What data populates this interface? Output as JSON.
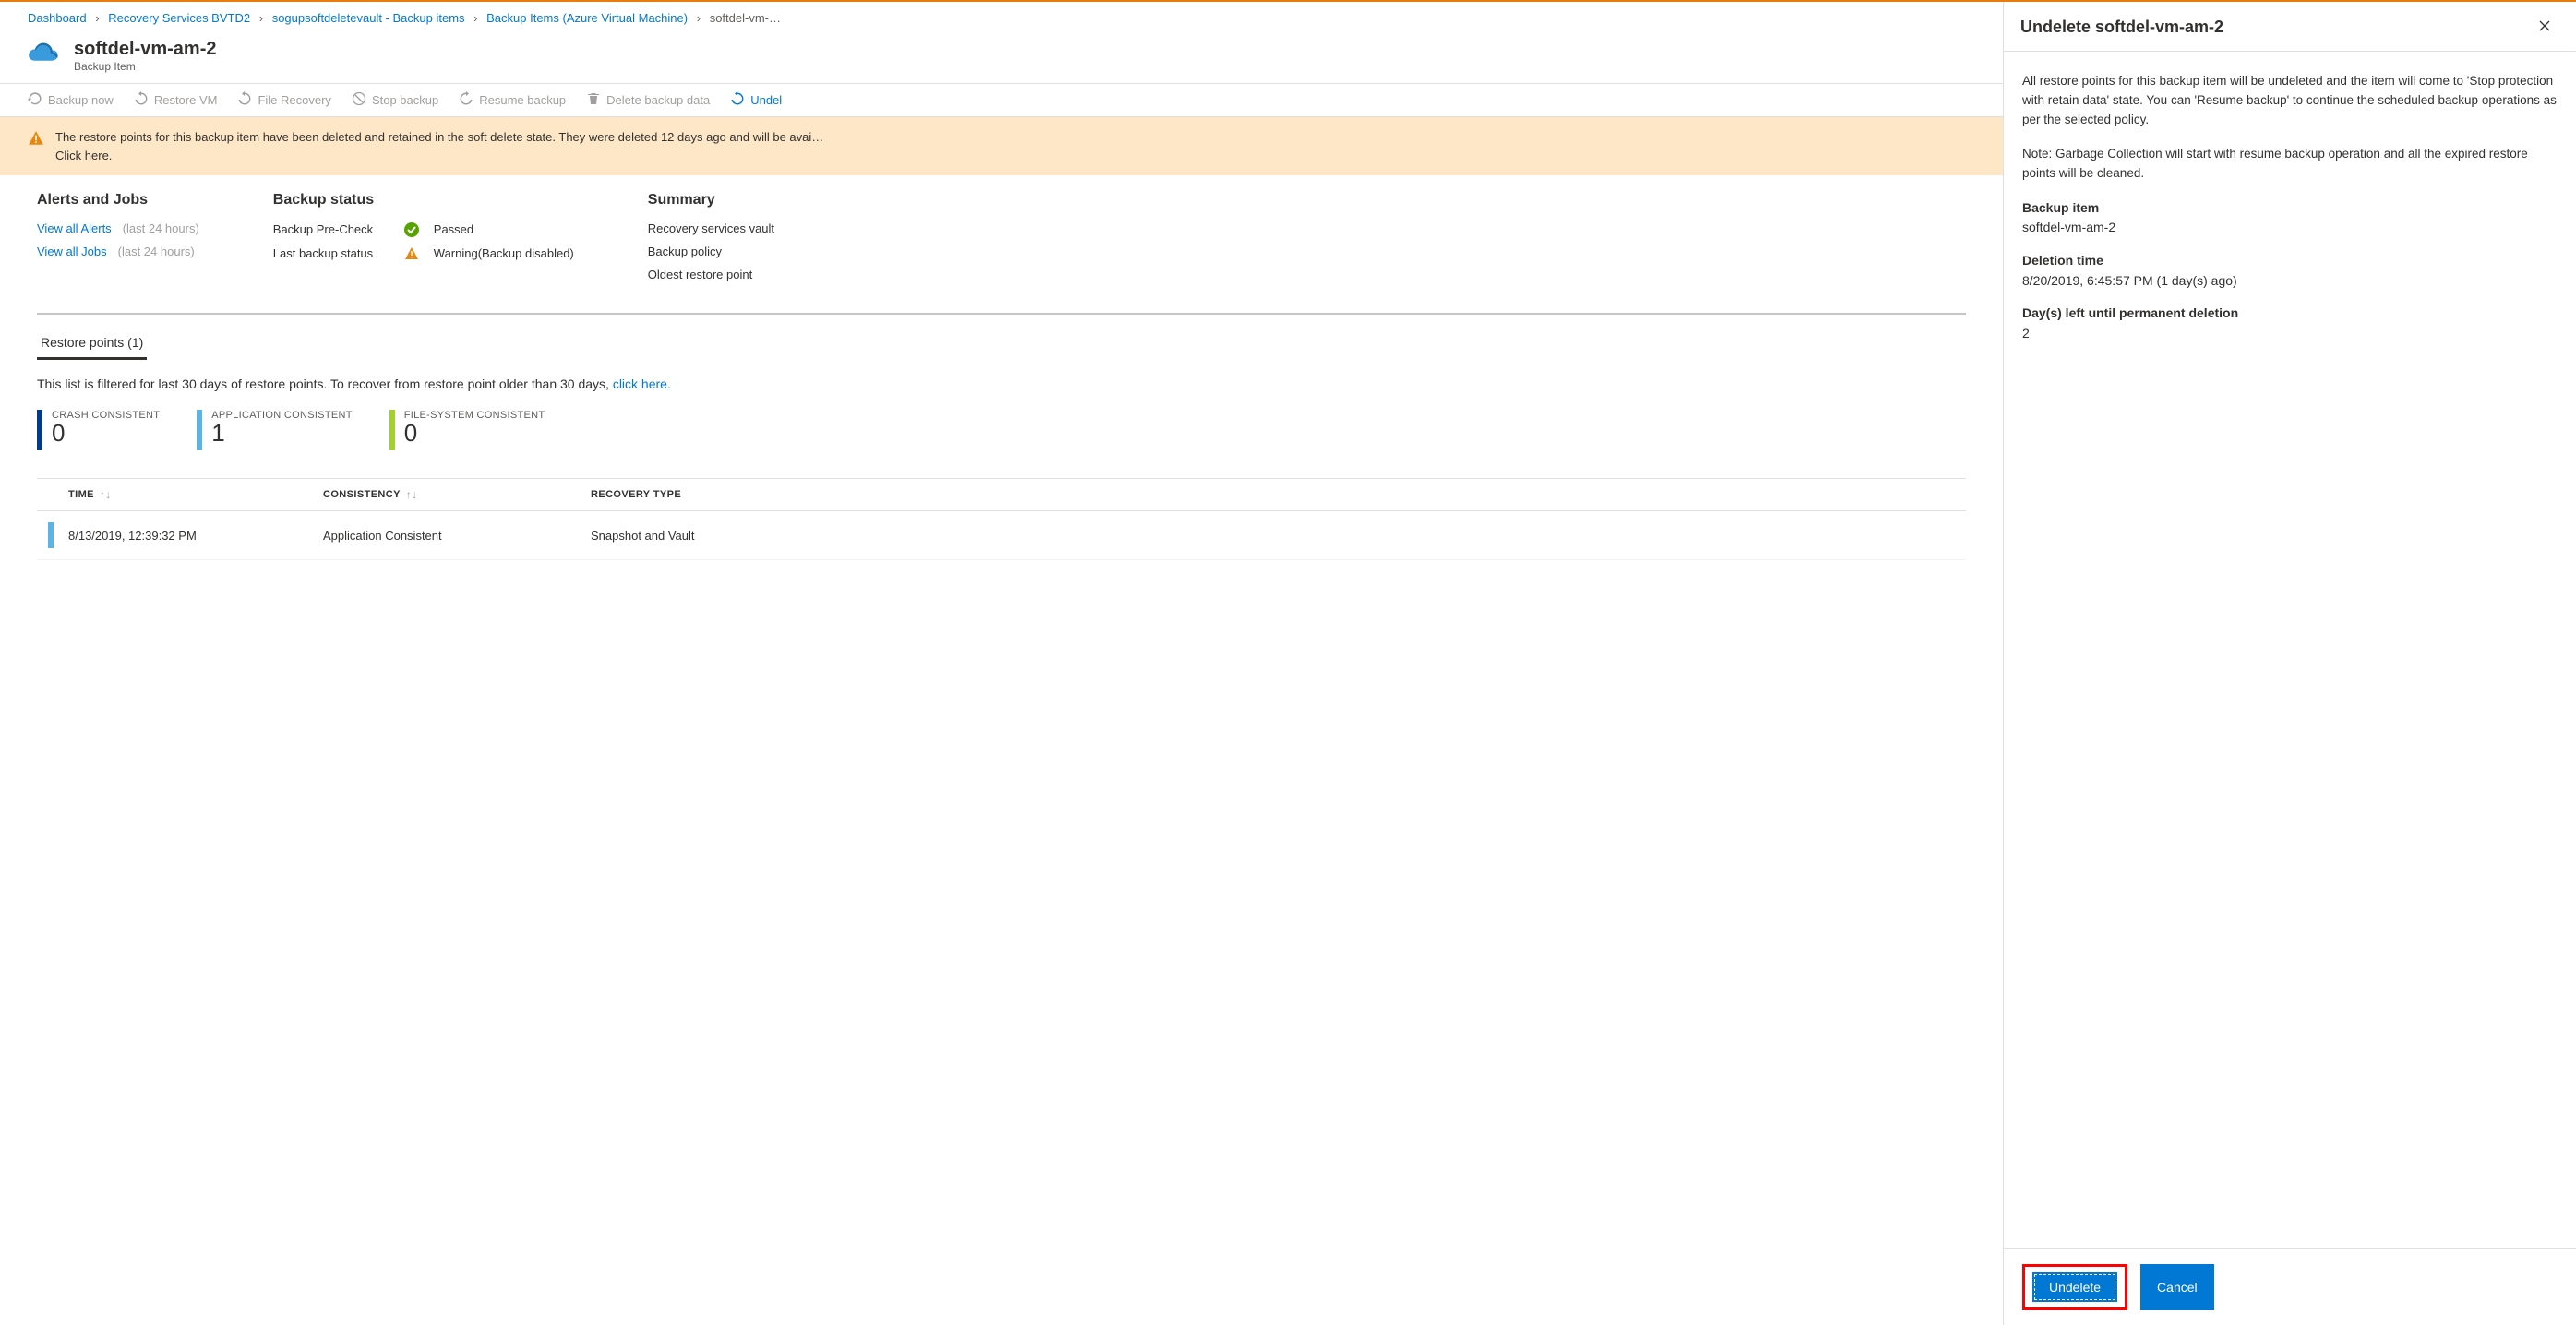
{
  "breadcrumb": {
    "items": [
      "Dashboard",
      "Recovery Services BVTD2",
      "sogupsoftdeletevault - Backup items",
      "Backup Items (Azure Virtual Machine)"
    ],
    "current": "softdel-vm-…"
  },
  "title": {
    "name": "softdel-vm-am-2",
    "subtitle": "Backup Item"
  },
  "toolbar": {
    "backup_now": "Backup now",
    "restore_vm": "Restore VM",
    "file_recovery": "File Recovery",
    "stop_backup": "Stop backup",
    "resume_backup": "Resume backup",
    "delete_backup": "Delete backup data",
    "undelete": "Undel"
  },
  "banner": {
    "text": "The restore points for this backup item have been deleted and retained in the soft delete state. They were deleted 12 days ago and will be avai…",
    "click_here": "Click here."
  },
  "sections": {
    "alerts": {
      "title": "Alerts and Jobs",
      "view_alerts": "View all Alerts",
      "view_jobs": "View all Jobs",
      "hours_suffix": "(last 24 hours)"
    },
    "backup_status": {
      "title": "Backup status",
      "precheck_label": "Backup Pre-Check",
      "precheck_value": "Passed",
      "last_label": "Last backup status",
      "last_value": "Warning(Backup disabled)"
    },
    "summary": {
      "title": "Summary",
      "vault": "Recovery services vault",
      "policy": "Backup policy",
      "oldest": "Oldest restore point"
    }
  },
  "restore_tab": "Restore points (1)",
  "filter_note_prefix": "This list is filtered for last 30 days of restore points. To recover from restore point older than 30 days, ",
  "filter_note_link": "click here.",
  "counters": {
    "crash": {
      "label": "CRASH CONSISTENT",
      "value": "0",
      "color": "#003a8c"
    },
    "app": {
      "label": "APPLICATION CONSISTENT",
      "value": "1",
      "color": "#5bb3e6"
    },
    "fs": {
      "label": "FILE-SYSTEM CONSISTENT",
      "value": "0",
      "color": "#a4cf30"
    }
  },
  "grid": {
    "headers": {
      "time": "TIME",
      "consistency": "CONSISTENCY",
      "recovery": "RECOVERY TYPE"
    },
    "rows": [
      {
        "time": "8/13/2019, 12:39:32 PM",
        "consistency": "Application Consistent",
        "recovery": "Snapshot and Vault"
      }
    ]
  },
  "blade": {
    "title": "Undelete softdel-vm-am-2",
    "para1": "All restore points for this backup item will be undeleted and the item will come to 'Stop protection with retain data' state. You can 'Resume backup' to continue the scheduled backup operations as per the selected policy.",
    "para2": "Note: Garbage Collection will start with resume backup operation and all the expired restore points will be cleaned.",
    "kv": {
      "item_label": "Backup item",
      "item_value": "softdel-vm-am-2",
      "del_label": "Deletion time",
      "del_value": "8/20/2019, 6:45:57 PM (1 day(s) ago)",
      "days_label": "Day(s) left until permanent deletion",
      "days_value": "2"
    },
    "undelete_btn": "Undelete",
    "cancel_btn": "Cancel"
  }
}
